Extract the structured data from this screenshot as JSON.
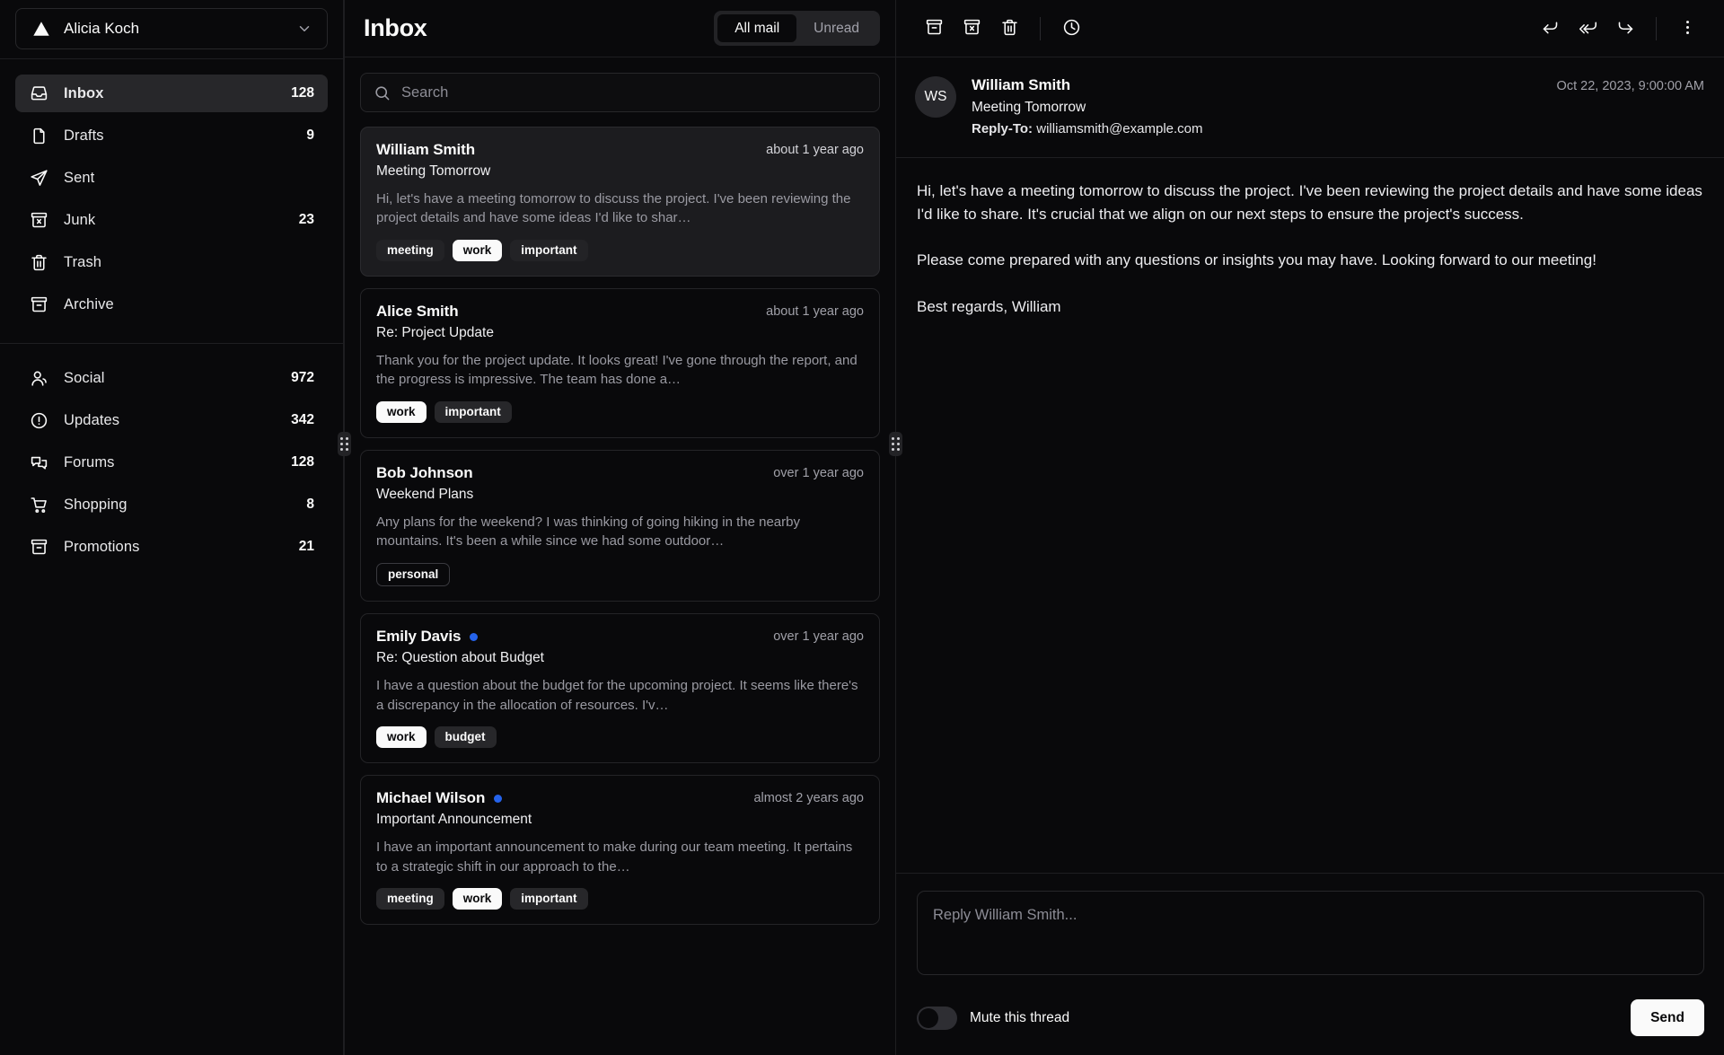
{
  "account": {
    "name": "Alicia Koch",
    "logo_icon": "triangle-logo-icon",
    "chevron_icon": "chevron-down-icon"
  },
  "sidebar": {
    "primary": [
      {
        "label": "Inbox",
        "count": "128",
        "icon": "inbox-icon",
        "active": true
      },
      {
        "label": "Drafts",
        "count": "9",
        "icon": "file-icon",
        "active": false
      },
      {
        "label": "Sent",
        "count": "",
        "icon": "send-icon",
        "active": false
      },
      {
        "label": "Junk",
        "count": "23",
        "icon": "archive-x-icon",
        "active": false
      },
      {
        "label": "Trash",
        "count": "",
        "icon": "trash-icon",
        "active": false
      },
      {
        "label": "Archive",
        "count": "",
        "icon": "archive-icon",
        "active": false
      }
    ],
    "secondary": [
      {
        "label": "Social",
        "count": "972",
        "icon": "users-icon",
        "active": false
      },
      {
        "label": "Updates",
        "count": "342",
        "icon": "alert-circle-icon",
        "active": false
      },
      {
        "label": "Forums",
        "count": "128",
        "icon": "messages-icon",
        "active": false
      },
      {
        "label": "Shopping",
        "count": "8",
        "icon": "shopping-cart-icon",
        "active": false
      },
      {
        "label": "Promotions",
        "count": "21",
        "icon": "archive-icon",
        "active": false
      }
    ]
  },
  "list": {
    "title": "Inbox",
    "tabs": [
      {
        "label": "All mail",
        "selected": true
      },
      {
        "label": "Unread",
        "selected": false
      }
    ],
    "search": {
      "placeholder": "Search",
      "value": "",
      "icon": "search-icon"
    },
    "items": [
      {
        "name": "William Smith",
        "date": "about 1 year ago",
        "subject": "Meeting Tomorrow",
        "preview": "Hi, let's have a meeting tomorrow to discuss the project. I've been reviewing the project details and have some ideas I'd like to shar…",
        "unread": false,
        "selected": true,
        "tags": [
          {
            "label": "meeting",
            "variant": "secondary"
          },
          {
            "label": "work",
            "variant": "default"
          },
          {
            "label": "important",
            "variant": "secondary"
          }
        ]
      },
      {
        "name": "Alice Smith",
        "date": "about 1 year ago",
        "subject": "Re: Project Update",
        "preview": "Thank you for the project update. It looks great! I've gone through the report, and the progress is impressive. The team has done a…",
        "unread": false,
        "selected": false,
        "tags": [
          {
            "label": "work",
            "variant": "default"
          },
          {
            "label": "important",
            "variant": "secondary"
          }
        ]
      },
      {
        "name": "Bob Johnson",
        "date": "over 1 year ago",
        "subject": "Weekend Plans",
        "preview": "Any plans for the weekend? I was thinking of going hiking in the nearby mountains. It's been a while since we had some outdoor…",
        "unread": false,
        "selected": false,
        "tags": [
          {
            "label": "personal",
            "variant": "outline"
          }
        ]
      },
      {
        "name": "Emily Davis",
        "date": "over 1 year ago",
        "subject": "Re: Question about Budget",
        "preview": "I have a question about the budget for the upcoming project. It seems like there's a discrepancy in the allocation of resources. I'v…",
        "unread": true,
        "selected": false,
        "tags": [
          {
            "label": "work",
            "variant": "default"
          },
          {
            "label": "budget",
            "variant": "secondary"
          }
        ]
      },
      {
        "name": "Michael Wilson",
        "date": "almost 2 years ago",
        "subject": "Important Announcement",
        "preview": "I have an important announcement to make during our team meeting. It pertains to a strategic shift in our approach to the…",
        "unread": true,
        "selected": false,
        "tags": [
          {
            "label": "meeting",
            "variant": "secondary"
          },
          {
            "label": "work",
            "variant": "default"
          },
          {
            "label": "important",
            "variant": "secondary"
          }
        ]
      }
    ]
  },
  "reader": {
    "toolbar": {
      "archive": "archive-icon",
      "junk": "archive-x-icon",
      "trash": "trash-icon",
      "snooze": "clock-icon",
      "reply": "reply-icon",
      "reply_all": "reply-all-icon",
      "forward": "forward-icon",
      "more": "more-vertical-icon"
    },
    "avatar_initials": "WS",
    "from": "William Smith",
    "subject": "Meeting Tomorrow",
    "reply_to_label": "Reply-To:",
    "reply_to_email": "williamsmith@example.com",
    "date": "Oct 22, 2023, 9:00:00 AM",
    "body": "Hi, let's have a meeting tomorrow to discuss the project. I've been reviewing the project details and have some ideas I'd like to share. It's crucial that we align on our next steps to ensure the project's success.\n\nPlease come prepared with any questions or insights you may have. Looking forward to our meeting!\n\nBest regards, William",
    "reply_placeholder": "Reply William Smith...",
    "reply_value": "",
    "mute_label": "Mute this thread",
    "mute_on": false,
    "send_label": "Send"
  },
  "colors": {
    "background": "#09090b",
    "accent_unread": "#2563eb",
    "foreground": "#fafafa",
    "muted": "#a1a1aa",
    "border": "#27272a",
    "selected_card": "#1c1c1f"
  }
}
